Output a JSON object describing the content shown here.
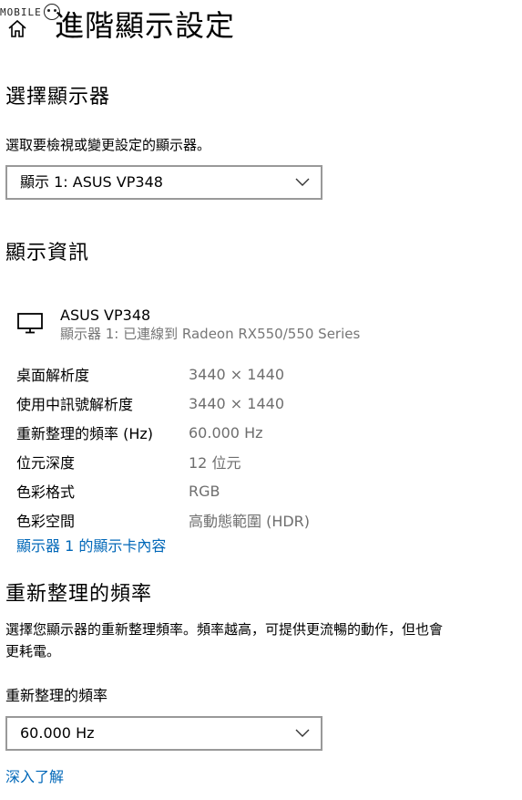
{
  "header": {
    "watermark_text": "MOBILE",
    "title": "進階顯示設定"
  },
  "select_display": {
    "title": "選擇顯示器",
    "description": "選取要檢視或變更設定的顯示器。",
    "dropdown_value": "顯示 1: ASUS VP348"
  },
  "display_info": {
    "title": "顯示資訊",
    "monitor_name": "ASUS VP348",
    "monitor_subtitle": "顯示器 1: 已連線到 Radeon RX550/550 Series",
    "rows": [
      {
        "label": "桌面解析度",
        "value": "3440 × 1440"
      },
      {
        "label": "使用中訊號解析度",
        "value": "3440 × 1440"
      },
      {
        "label": "重新整理的頻率 (Hz)",
        "value": "60.000 Hz"
      },
      {
        "label": "位元深度",
        "value": "12 位元"
      },
      {
        "label": "色彩格式",
        "value": "RGB"
      },
      {
        "label": "色彩空間",
        "value": "高動態範圍 (HDR)"
      }
    ],
    "adapter_link": "顯示器 1 的顯示卡內容"
  },
  "refresh_rate": {
    "title": "重新整理的頻率",
    "description_line1": "選擇您顯示器的重新整理頻率。頻率越高，可提供更流暢的動作，但也會",
    "description_line2": "更耗電。",
    "field_label": "重新整理的頻率",
    "dropdown_value": "60.000 Hz",
    "learn_more_link": "深入了解"
  },
  "colors": {
    "link": "#0067b8",
    "secondary_text": "#767676",
    "dropdown_border": "#999999"
  }
}
